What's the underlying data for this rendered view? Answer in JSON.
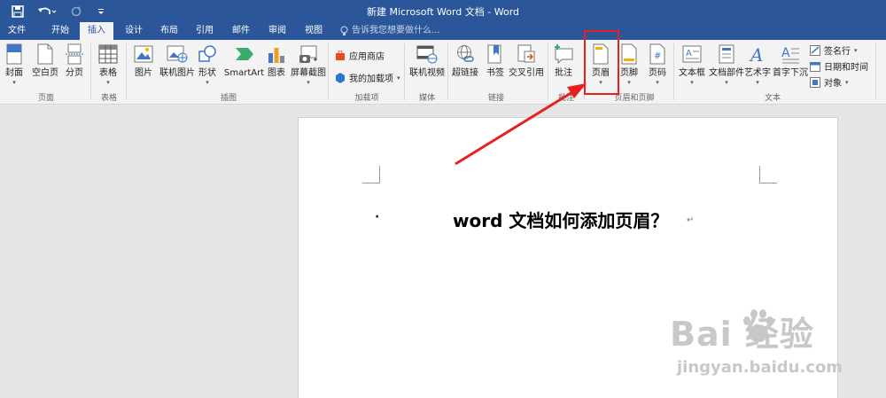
{
  "window": {
    "title": "新建 Microsoft Word 文档 - Word"
  },
  "quick_access": {
    "save_icon": "save-icon",
    "undo_icon": "undo-icon",
    "redo_icon": "redo-icon",
    "customize_icon": "customize-icon"
  },
  "tabs": [
    {
      "label": "文件"
    },
    {
      "label": "开始"
    },
    {
      "label": "插入"
    },
    {
      "label": "设计"
    },
    {
      "label": "布局"
    },
    {
      "label": "引用"
    },
    {
      "label": "邮件"
    },
    {
      "label": "审阅"
    },
    {
      "label": "视图"
    }
  ],
  "tell_me": {
    "placeholder": "告诉我您想要做什么..."
  },
  "ribbon": {
    "pages": {
      "cover": "封面",
      "blank": "空白页",
      "break": "分页",
      "group": "页面"
    },
    "tables": {
      "table": "表格",
      "group": "表格"
    },
    "illustrations": {
      "picture": "图片",
      "online_picture": "联机图片",
      "shapes": "形状",
      "smartart": "SmartArt",
      "chart": "图表",
      "screenshot": "屏幕截图",
      "group": "插图"
    },
    "addins": {
      "store": "应用商店",
      "my_addins": "我的加载项",
      "group": "加载项"
    },
    "media": {
      "online_video": "联机视频",
      "group": "媒体"
    },
    "links": {
      "hyperlink": "超链接",
      "bookmark": "书签",
      "cross_ref": "交叉引用",
      "group": "链接"
    },
    "comments": {
      "comment": "批注",
      "group": "批注"
    },
    "header_footer": {
      "header": "页眉",
      "footer": "页脚",
      "page_number": "页码",
      "group": "页眉和页脚"
    },
    "text": {
      "textbox": "文本框",
      "quick_parts": "文档部件",
      "wordart": "艺术字",
      "dropcap": "首字下沉",
      "signature": "签名行",
      "datetime": "日期和时间",
      "object": "对象",
      "group": "文本"
    }
  },
  "document": {
    "heading": "word 文档如何添加页眉？"
  },
  "watermark": {
    "brand": "Bai  经验",
    "site": "jingyan.baidu.com"
  },
  "colors": {
    "title_bar": "#2b579a",
    "ribbon_bg": "#f3f3f3",
    "annotation_red": "#e82020"
  }
}
